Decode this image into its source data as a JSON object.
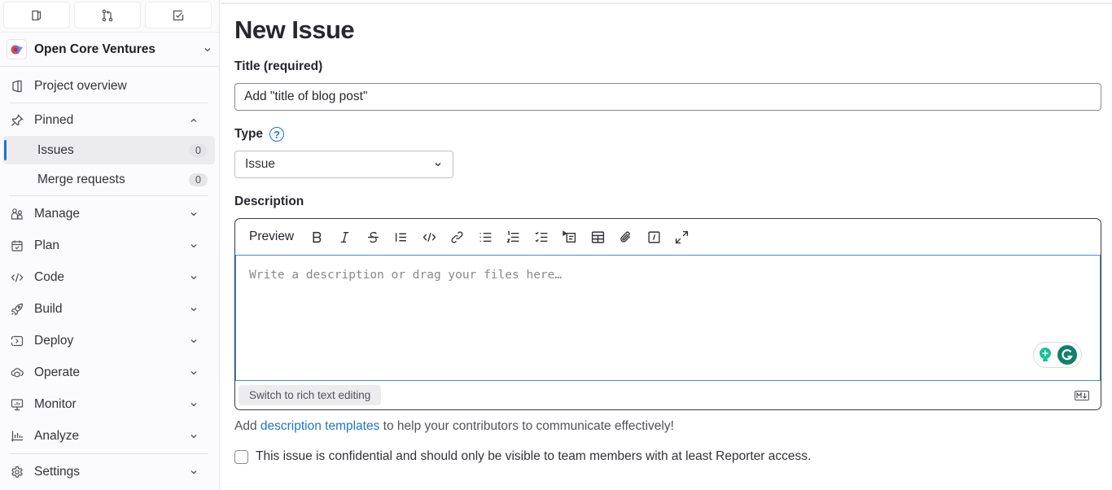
{
  "sidebar": {
    "top_buttons": [
      {
        "icon": "issues-icon",
        "tooltip": "Issues"
      },
      {
        "icon": "merge-request-icon",
        "tooltip": "Merge requests"
      },
      {
        "icon": "todo-icon",
        "tooltip": "To-Do list"
      }
    ],
    "context": {
      "name": "Open Core Ventures"
    },
    "project_overview": "Project overview",
    "pinned": {
      "label": "Pinned",
      "items": [
        {
          "label": "Issues",
          "count": "0",
          "active": true
        },
        {
          "label": "Merge requests",
          "count": "0",
          "active": false
        }
      ]
    },
    "sections": [
      {
        "label": "Manage",
        "icon": "users-icon"
      },
      {
        "label": "Plan",
        "icon": "calendar-icon"
      },
      {
        "label": "Code",
        "icon": "code-icon"
      },
      {
        "label": "Build",
        "icon": "rocket-icon"
      },
      {
        "label": "Deploy",
        "icon": "deploy-icon"
      },
      {
        "label": "Operate",
        "icon": "cloud-icon"
      },
      {
        "label": "Monitor",
        "icon": "monitor-icon"
      },
      {
        "label": "Analyze",
        "icon": "chart-icon"
      }
    ],
    "settings": "Settings"
  },
  "main": {
    "page_title": "New Issue",
    "title_label": "Title (required)",
    "title_value": "Add \"title of blog post\"",
    "type_label": "Type",
    "type_value": "Issue",
    "description_label": "Description",
    "editor": {
      "preview_label": "Preview",
      "toolbar": [
        "bold",
        "italic",
        "strikethrough",
        "quote",
        "code",
        "link",
        "bullet-list",
        "numbered-list",
        "task-list",
        "collapsible",
        "table",
        "attach-file",
        "slash-commands",
        "fullscreen"
      ],
      "placeholder": "Write a description or drag your files here…",
      "switch_label": "Switch to rich text editing",
      "markdown_badge": "M↓"
    },
    "hint_before": "Add ",
    "hint_link": "description templates",
    "hint_after": " to help your contributors to communicate effectively!",
    "confidential_label": "This issue is confidential and should only be visible to team members with at least Reporter access.",
    "confidential_checked": false
  },
  "colors": {
    "accent": "#1f75cb",
    "grammarly": "#15c39a"
  }
}
